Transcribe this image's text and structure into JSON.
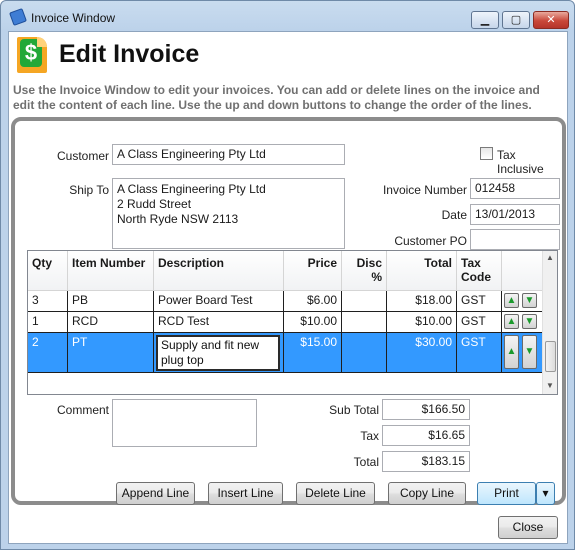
{
  "window": {
    "title": "Invoice Window",
    "min_glyph": "▁",
    "max_glyph": "▢",
    "close_glyph": "✕"
  },
  "header": {
    "icon": "dollar-invoice-icon",
    "icon_glyph": "$",
    "title": "Edit Invoice",
    "description": "Use the Invoice Window to edit your invoices. You can add or delete lines on the invoice and edit the content of each line. Use the up and down buttons to change the order of the lines."
  },
  "form": {
    "customer_label": "Customer",
    "customer_value": "A Class Engineering Pty Ltd",
    "ship_to_label": "Ship To",
    "ship_to_value": "A Class Engineering Pty Ltd\n2 Rudd Street\nNorth Ryde NSW 2113",
    "tax_inclusive_label": "Tax Inclusive",
    "tax_inclusive_checked": false,
    "invoice_number_label": "Invoice Number",
    "invoice_number_value": "012458",
    "date_label": "Date",
    "date_value": "13/01/2013",
    "customer_po_label": "Customer PO",
    "customer_po_value": ""
  },
  "grid": {
    "columns": [
      "Qty",
      "Item Number",
      "Description",
      "Price",
      "Disc\n%",
      "Total",
      "Tax\nCode"
    ],
    "rows": [
      {
        "qty": "3",
        "item": "PB",
        "description": "Power Board Test",
        "price": "$6.00",
        "disc": "",
        "total": "$18.00",
        "tax": "GST"
      },
      {
        "qty": "1",
        "item": "RCD",
        "description": "RCD Test",
        "price": "$10.00",
        "disc": "",
        "total": "$10.00",
        "tax": "GST"
      },
      {
        "qty": "2",
        "item": "PT",
        "description": "Supply and fit new plug top",
        "price": "$15.00",
        "disc": "",
        "total": "$30.00",
        "tax": "GST"
      }
    ],
    "selected_row": 2,
    "up_glyph": "▲",
    "down_glyph": "▼"
  },
  "totals": {
    "comment_label": "Comment",
    "comment_value": "",
    "subtotal_label": "Sub Total",
    "subtotal_value": "$166.50",
    "tax_label": "Tax",
    "tax_value": "$16.65",
    "total_label": "Total",
    "total_value": "$183.15"
  },
  "actions": {
    "append_line": "Append Line",
    "insert_line": "Insert Line",
    "delete_line": "Delete Line",
    "copy_line": "Copy Line",
    "print": "Print",
    "print_dropdown_glyph": "▾"
  },
  "footer": {
    "close": "Close"
  }
}
